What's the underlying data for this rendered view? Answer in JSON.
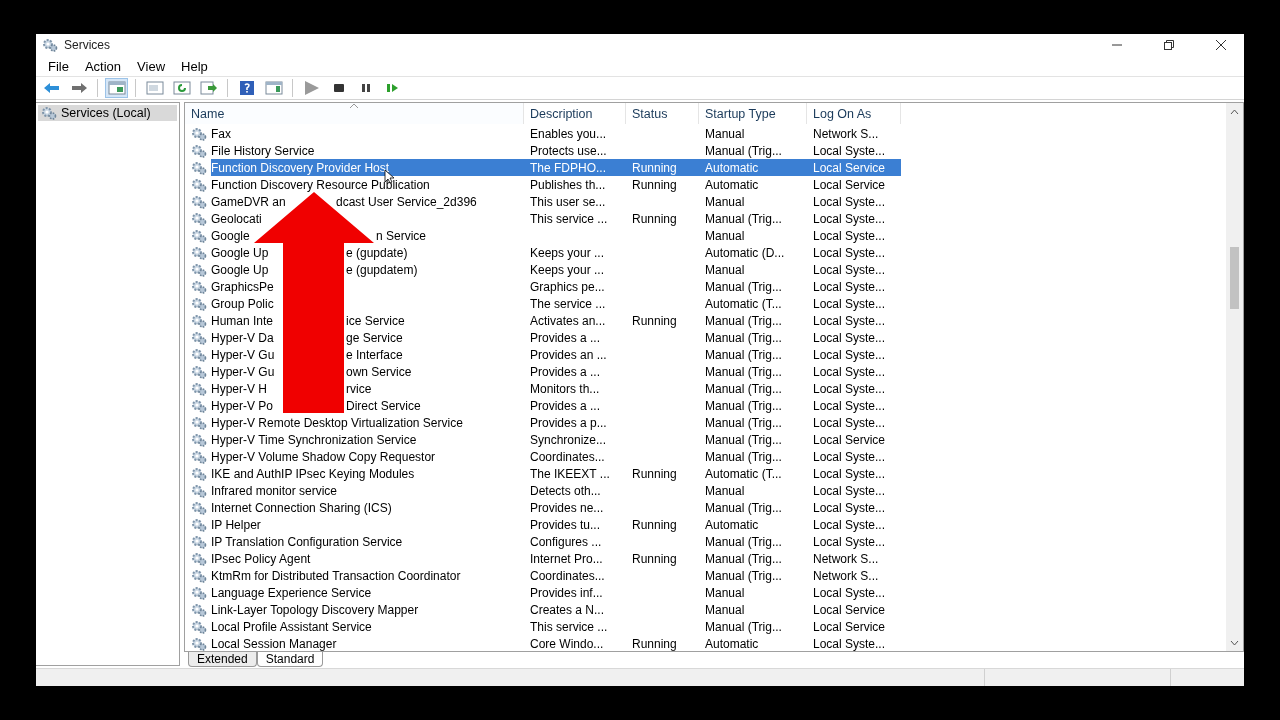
{
  "window": {
    "title": "Services"
  },
  "menu": [
    "File",
    "Action",
    "View",
    "Help"
  ],
  "tree": [
    {
      "label": "Services (Local)",
      "selected": true
    }
  ],
  "table": {
    "columns": [
      {
        "label": "Name",
        "sorted": true
      },
      {
        "label": "Description",
        "sorted": false
      },
      {
        "label": "Status",
        "sorted": false
      },
      {
        "label": "Startup Type",
        "sorted": false
      },
      {
        "label": "Log On As",
        "sorted": false
      }
    ],
    "rows": [
      {
        "name": "Fax",
        "description": "Enables you...",
        "startup_type": "Manual",
        "log_on_as": "Network S...",
        "selected": false
      },
      {
        "name": "File History Service",
        "description": "Protects use...",
        "startup_type": "Manual (Trig...",
        "log_on_as": "Local Syste...",
        "selected": false
      },
      {
        "name": "Function Discovery Provider Host",
        "description": "The FDPHO...",
        "status": "Running",
        "startup_type": "Automatic",
        "log_on_as": "Local Service",
        "selected": true
      },
      {
        "name": "Function Discovery Resource Publication",
        "description": "Publishes th...",
        "status": "Running",
        "startup_type": "Automatic",
        "log_on_as": "Local Service",
        "selected": false
      },
      {
        "name": "GameDVR an",
        "name_after": "dcast User Service_2d396",
        "description": "This user se...",
        "startup_type": "Manual",
        "log_on_as": "Local Syste...",
        "selected": false
      },
      {
        "name": "Geolocati",
        "description": "This service ...",
        "status": "Running",
        "startup_type": "Manual (Trig...",
        "log_on_as": "Local Syste...",
        "selected": false
      },
      {
        "name": "Google",
        "name_after": "n Service",
        "startup_type": "Manual",
        "log_on_as": "Local Syste...",
        "selected": false
      },
      {
        "name": "Google Up",
        "name_after": "e (gupdate)",
        "description": "Keeps your ...",
        "startup_type": "Automatic (D...",
        "log_on_as": "Local Syste...",
        "selected": false
      },
      {
        "name": "Google Up",
        "name_after": "e (gupdatem)",
        "description": "Keeps your ...",
        "startup_type": "Manual",
        "log_on_as": "Local Syste...",
        "selected": false
      },
      {
        "name": "GraphicsPe",
        "description": "Graphics pe...",
        "startup_type": "Manual (Trig...",
        "log_on_as": "Local Syste...",
        "selected": false
      },
      {
        "name": "Group Polic",
        "description": "The service ...",
        "startup_type": "Automatic (T...",
        "log_on_as": "Local Syste...",
        "selected": false
      },
      {
        "name": "Human Inte",
        "name_after": "ice Service",
        "description": "Activates an...",
        "status": "Running",
        "startup_type": "Manual (Trig...",
        "log_on_as": "Local Syste...",
        "selected": false
      },
      {
        "name": "Hyper-V Da",
        "name_after": "ge Service",
        "description": "Provides a ...",
        "startup_type": "Manual (Trig...",
        "log_on_as": "Local Syste...",
        "selected": false
      },
      {
        "name": "Hyper-V Gu",
        "name_after": "e Interface",
        "description": "Provides an ...",
        "startup_type": "Manual (Trig...",
        "log_on_as": "Local Syste...",
        "selected": false
      },
      {
        "name": "Hyper-V Gu",
        "name_after": "own Service",
        "description": "Provides a ...",
        "startup_type": "Manual (Trig...",
        "log_on_as": "Local Syste...",
        "selected": false
      },
      {
        "name": "Hyper-V H",
        "name_after": "rvice",
        "description": "Monitors th...",
        "startup_type": "Manual (Trig...",
        "log_on_as": "Local Syste...",
        "selected": false
      },
      {
        "name": "Hyper-V Po",
        "name_after": "Direct Service",
        "description": "Provides a ...",
        "startup_type": "Manual (Trig...",
        "log_on_as": "Local Syste...",
        "selected": false
      },
      {
        "name": "Hyper-V Remote Desktop Virtualization Service",
        "description": "Provides a p...",
        "startup_type": "Manual (Trig...",
        "log_on_as": "Local Syste...",
        "selected": false
      },
      {
        "name": "Hyper-V Time Synchronization Service",
        "description": "Synchronize...",
        "startup_type": "Manual (Trig...",
        "log_on_as": "Local Service",
        "selected": false
      },
      {
        "name": "Hyper-V Volume Shadow Copy Requestor",
        "description": "Coordinates...",
        "startup_type": "Manual (Trig...",
        "log_on_as": "Local Syste...",
        "selected": false
      },
      {
        "name": "IKE and AuthIP IPsec Keying Modules",
        "description": "The IKEEXT ...",
        "status": "Running",
        "startup_type": "Automatic (T...",
        "log_on_as": "Local Syste...",
        "selected": false
      },
      {
        "name": "Infrared monitor service",
        "description": "Detects oth...",
        "startup_type": "Manual",
        "log_on_as": "Local Syste...",
        "selected": false
      },
      {
        "name": "Internet Connection Sharing (ICS)",
        "description": "Provides ne...",
        "startup_type": "Manual (Trig...",
        "log_on_as": "Local Syste...",
        "selected": false
      },
      {
        "name": "IP Helper",
        "description": "Provides tu...",
        "status": "Running",
        "startup_type": "Automatic",
        "log_on_as": "Local Syste...",
        "selected": false
      },
      {
        "name": "IP Translation Configuration Service",
        "description": "Configures ...",
        "startup_type": "Manual (Trig...",
        "log_on_as": "Local Syste...",
        "selected": false
      },
      {
        "name": "IPsec Policy Agent",
        "description": "Internet Pro...",
        "status": "Running",
        "startup_type": "Manual (Trig...",
        "log_on_as": "Network S...",
        "selected": false
      },
      {
        "name": "KtmRm for Distributed Transaction Coordinator",
        "description": "Coordinates...",
        "startup_type": "Manual (Trig...",
        "log_on_as": "Network S...",
        "selected": false
      },
      {
        "name": "Language Experience Service",
        "description": "Provides inf...",
        "startup_type": "Manual",
        "log_on_as": "Local Syste...",
        "selected": false
      },
      {
        "name": "Link-Layer Topology Discovery Mapper",
        "description": "Creates a N...",
        "startup_type": "Manual",
        "log_on_as": "Local Service",
        "selected": false
      },
      {
        "name": "Local Profile Assistant Service",
        "description": "This service ...",
        "startup_type": "Manual (Trig...",
        "log_on_as": "Local Service",
        "selected": false
      },
      {
        "name": "Local Session Manager",
        "description": "Core Windo...",
        "status": "Running",
        "startup_type": "Automatic",
        "log_on_as": "Local Syste...",
        "selected": false
      }
    ]
  },
  "tabs": [
    {
      "label": "Extended",
      "selected": false
    },
    {
      "label": "Standard",
      "selected": true
    }
  ],
  "overlay_arrow": true
}
